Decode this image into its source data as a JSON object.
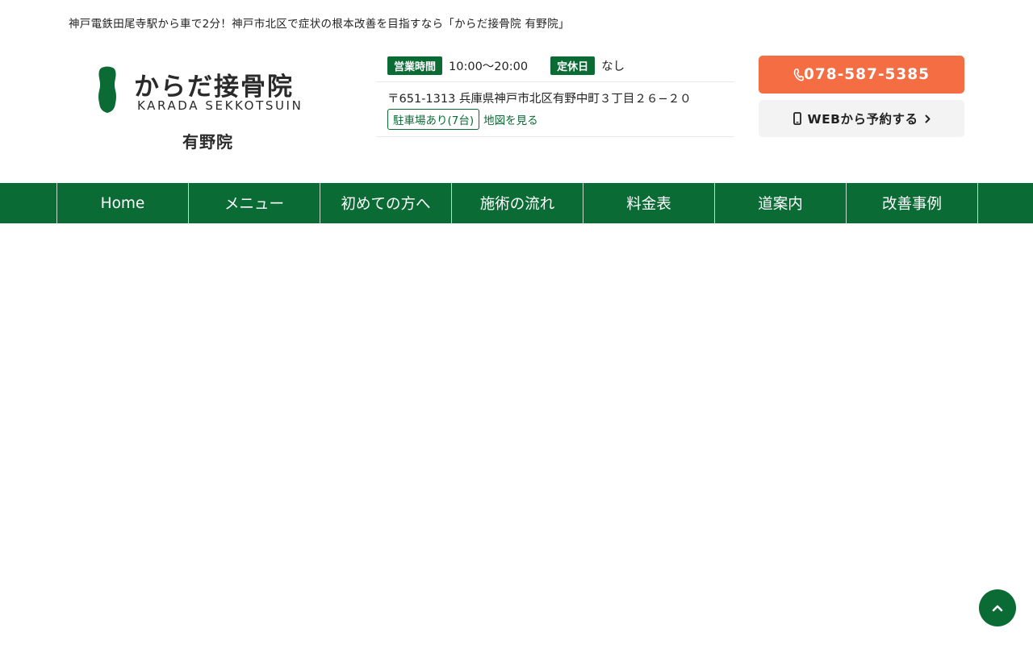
{
  "header": {
    "tagline": "神戸電鉄田尾寺駅から車で2分！神戸市北区で症状の根本改善を目指すなら「からだ接骨院 有野院」"
  },
  "logo": {
    "name": "からだ接骨院",
    "roman": "KARADA SEKKOTSUIN",
    "branch": "有野院"
  },
  "info": {
    "hours_label": "営業時間",
    "hours_value": "10:00〜20:00",
    "closed_label": "定休日",
    "closed_value": "なし",
    "address": "〒651-1313 兵庫県神戸市北区有野中町３丁目２６−２０",
    "parking": "駐車場あり(7台)",
    "map_link": "地図を見る"
  },
  "cta": {
    "tel": "078-587-5385",
    "web": "WEBから予約する"
  },
  "nav": {
    "items": [
      {
        "label": "Home"
      },
      {
        "label": "メニュー"
      },
      {
        "label": "初めての方へ"
      },
      {
        "label": "施術の流れ"
      },
      {
        "label": "料金表"
      },
      {
        "label": "道案内"
      },
      {
        "label": "改善事例"
      }
    ]
  },
  "icons": {
    "phone": "phone-icon",
    "mobile": "mobile-phone-icon",
    "chevron": "chevron-right-icon",
    "to_top": "chevron-up-icon"
  },
  "colors": {
    "brand_green": "#0b6b35",
    "tel_orange": "#f46d43",
    "web_button_bg": "#f3f3f3"
  }
}
